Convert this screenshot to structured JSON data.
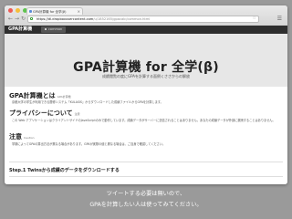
{
  "browser": {
    "tab_title": "GPA計算機 for 全学(β)",
    "tab_close": "×",
    "url_host": "https://dl.dropboxusercontent.com",
    "url_path": "/u/1852165/gpacalc/common.html",
    "colors": {
      "close": "#ee5b55",
      "minimize": "#f6be3a",
      "maximize": "#5fc350"
    }
  },
  "site": {
    "brand": "GPA計算機",
    "nav_item": "common"
  },
  "hero": {
    "title": "GPA計算機 for 全学(β)",
    "subtitle": "成績閲覧の度にGPAを計算する面倒くささからの解放"
  },
  "sections": [
    {
      "heading": "GPA計算機とは",
      "note": "GPA計算機",
      "body": "京都大学の学生が利用できる履修システム「KULASIS」からダウンロードした成績ファイルからGPAを計算します。"
    },
    {
      "heading": "プライバシーについて",
      "note": "注意",
      "body": "この Web アプリケーションはクライアントサイドのJavaScriptのみで動作しています。成績データがサーバーに送信されることはありません。あなたの成績データが外部に漏洩することはありません。"
    },
    {
      "heading": "注意",
      "note": "Caution",
      "body": "学期によってGPAの算出方法が異なる場合があります。GPAが実際の値と異なる場合は、ご自身で確認してください。"
    }
  ],
  "step_heading": "Step.1 Twinsから成績のデータをダウンロードする",
  "caption": {
    "line1": "ツイートする必要は無いので、",
    "line2": "GPAを計算したい人は使ってみてください。"
  }
}
